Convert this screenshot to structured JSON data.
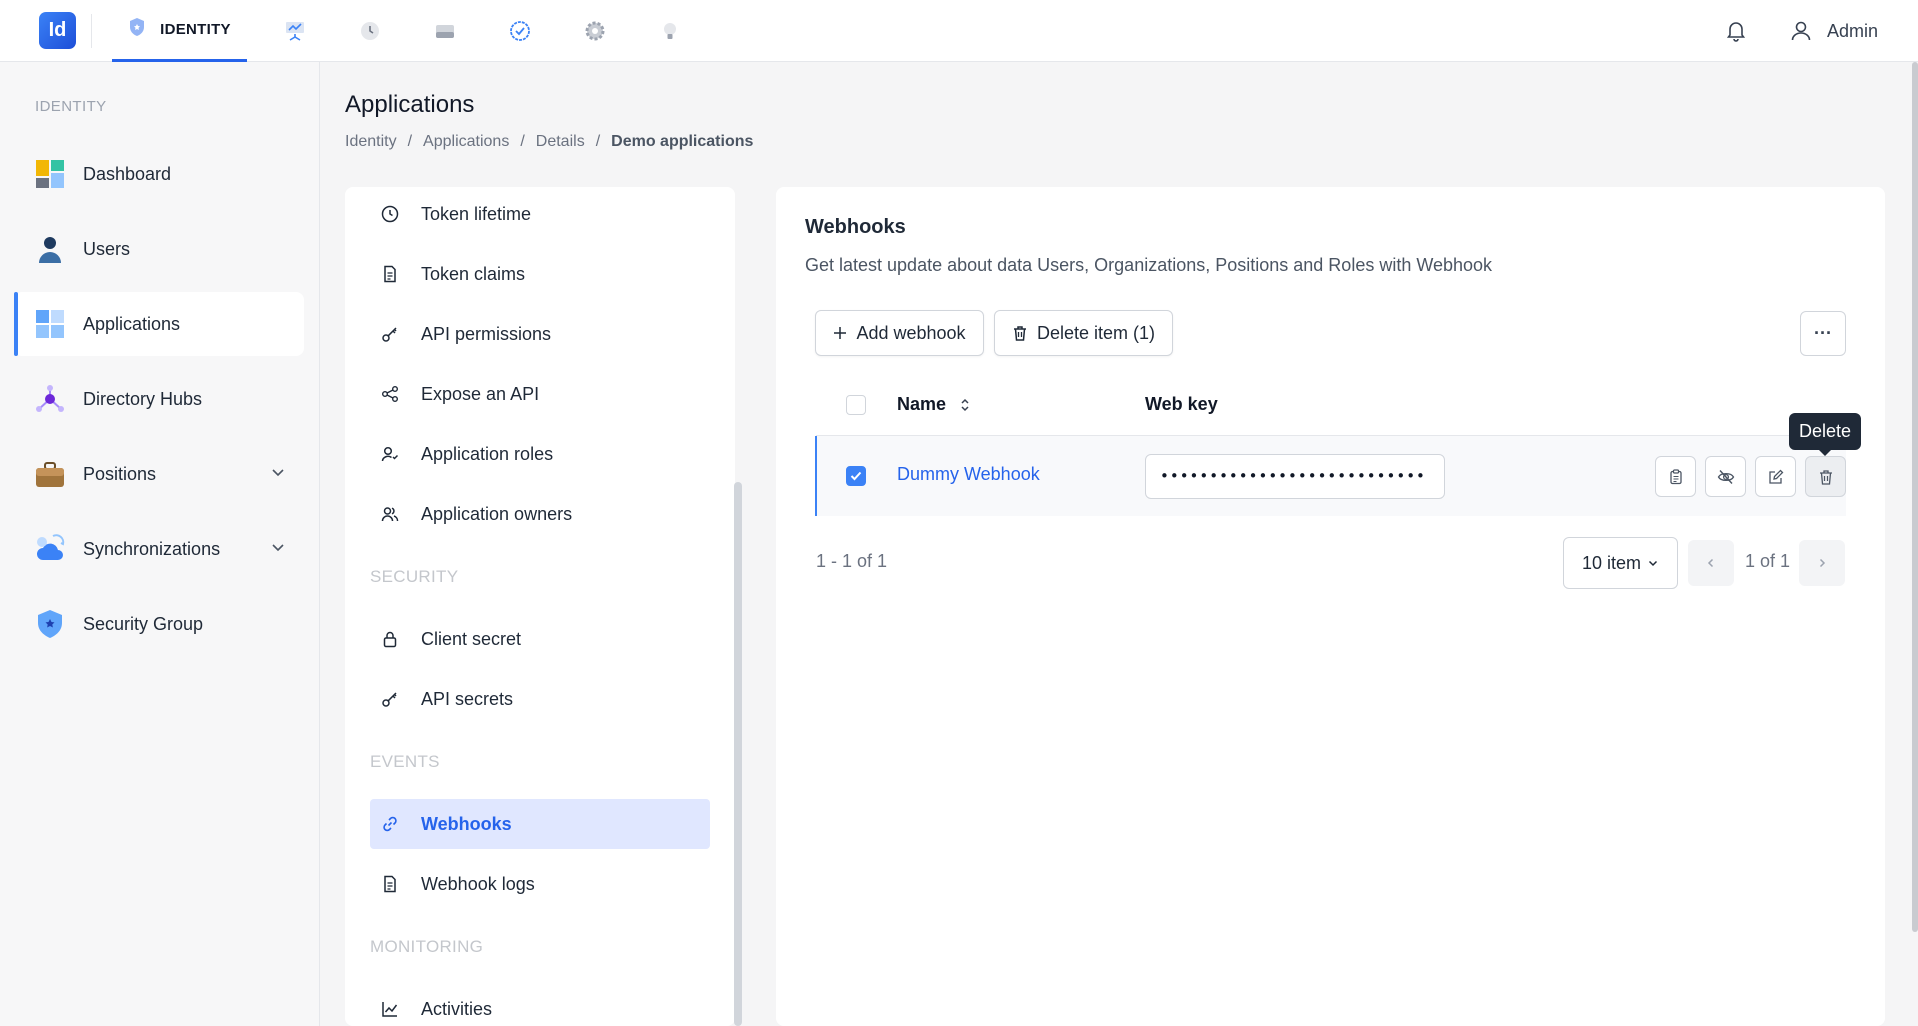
{
  "topbar": {
    "logo_text": "Id",
    "active_module": "IDENTITY",
    "modules": [
      "dashboard-monitor",
      "history",
      "storage",
      "verified",
      "settings",
      "ideas"
    ],
    "user_name": "Admin"
  },
  "sidebar": {
    "heading": "IDENTITY",
    "items": [
      {
        "label": "Dashboard",
        "icon": "dashboard-icon"
      },
      {
        "label": "Users",
        "icon": "user-icon"
      },
      {
        "label": "Applications",
        "icon": "applications-icon",
        "active": true
      },
      {
        "label": "Directory Hubs",
        "icon": "directory-hub-icon"
      },
      {
        "label": "Positions",
        "icon": "briefcase-icon",
        "expandable": true
      },
      {
        "label": "Synchronizations",
        "icon": "cloud-sync-icon",
        "expandable": true
      },
      {
        "label": "Security Group",
        "icon": "shield-icon"
      }
    ]
  },
  "page": {
    "title": "Applications",
    "breadcrumb": [
      "Identity",
      "Applications",
      "Details",
      "Demo applications"
    ]
  },
  "settings_menu": {
    "items_top": [
      {
        "label": "Token lifetime",
        "icon": "clock-icon"
      },
      {
        "label": "Token claims",
        "icon": "document-icon"
      },
      {
        "label": "API permissions",
        "icon": "key-icon"
      },
      {
        "label": "Expose an API",
        "icon": "share-icon"
      },
      {
        "label": "Application roles",
        "icon": "user-role-icon"
      },
      {
        "label": "Application owners",
        "icon": "users-icon"
      }
    ],
    "section_security": "SECURITY",
    "items_security": [
      {
        "label": "Client secret",
        "icon": "lock-icon"
      },
      {
        "label": "API secrets",
        "icon": "key-icon"
      }
    ],
    "section_events": "EVENTS",
    "items_events": [
      {
        "label": "Webhooks",
        "icon": "link-icon",
        "active": true
      },
      {
        "label": "Webhook logs",
        "icon": "document-icon"
      }
    ],
    "section_monitoring": "MONITORING",
    "items_monitoring": [
      {
        "label": "Activities",
        "icon": "chart-line-icon"
      }
    ]
  },
  "webhooks": {
    "title": "Webhooks",
    "description": "Get latest update about data Users, Organizations, Positions and Roles with Webhook",
    "add_button": "Add webhook",
    "delete_button": "Delete item (1)",
    "more_button": "···",
    "columns": {
      "name": "Name",
      "web_key": "Web key"
    },
    "rows": [
      {
        "name": "Dummy Webhook",
        "web_key_masked": "•••••••••••••••••••••••••••",
        "selected": true
      }
    ],
    "row_actions": [
      "copy-icon",
      "hide-icon",
      "edit-icon",
      "trash-icon"
    ],
    "tooltip": "Delete",
    "pagination": {
      "range": "1 - 1 of 1",
      "page_size": "10 item",
      "page_label": "1 of 1"
    }
  },
  "colors": {
    "accent": "#2563eb",
    "active_menu_bg": "#e0e7ff",
    "tooltip_bg": "#1f2937"
  }
}
